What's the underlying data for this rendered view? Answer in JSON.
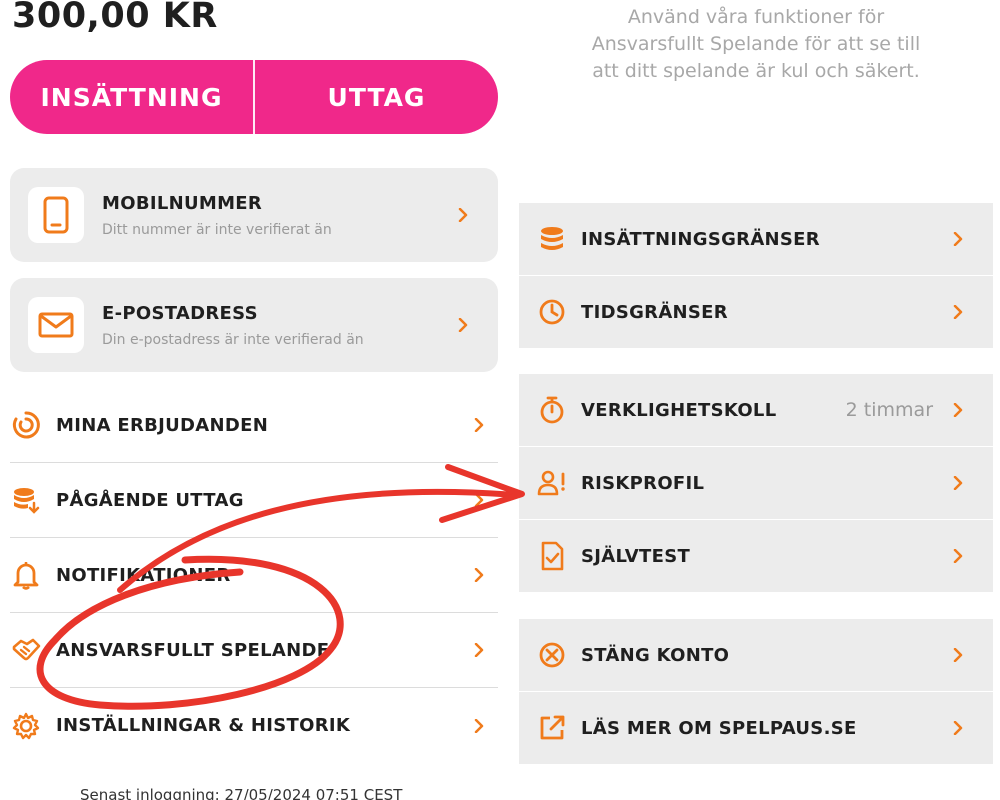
{
  "balance": "300,00 KR",
  "actions": {
    "deposit": "INSÄTTNING",
    "withdraw": "UTTAG"
  },
  "cards": [
    {
      "title": "MOBILNUMMER",
      "subtitle": "Ditt nummer är inte verifierat än",
      "icon": "phone-icon"
    },
    {
      "title": "E-POSTADRESS",
      "subtitle": "Din e-postadress är inte verifierad än",
      "icon": "mail-icon"
    }
  ],
  "menu": [
    {
      "label": "MINA ERBJUDANDEN",
      "icon": "offers-icon"
    },
    {
      "label": "PÅGÅENDE UTTAG",
      "icon": "coins-icon"
    },
    {
      "label": "NOTIFIKATIONER",
      "icon": "bell-icon"
    },
    {
      "label": "ANSVARSFULLT SPELANDE",
      "icon": "handshake-icon"
    },
    {
      "label": "INSTÄLLNINGAR & HISTORIK",
      "icon": "gear-icon"
    }
  ],
  "info_text": "Använd våra funktioner för Ansvarsfullt Spelande för att se till att ditt spelande är kul och säkert.",
  "responsible": {
    "limits": [
      {
        "label": "INSÄTTNINGSGRÄNSER",
        "icon": "coins-icon"
      },
      {
        "label": "TIDSGRÄNSER",
        "icon": "clock-icon"
      }
    ],
    "checks": [
      {
        "label": "VERKLIGHETSKOLL",
        "value": "2 timmar",
        "icon": "stopwatch-icon"
      },
      {
        "label": "RISKPROFIL",
        "icon": "user-alert-icon"
      },
      {
        "label": "SJÄLVTEST",
        "icon": "file-check-icon"
      }
    ],
    "account": [
      {
        "label": "STÄNG KONTO",
        "icon": "close-circle-icon"
      },
      {
        "label": "LÄS MER OM SPELPAUS.SE",
        "icon": "external-link-icon"
      }
    ]
  },
  "footer": "Senast inloggning: 27/05/2024 07:51 CEST",
  "colors": {
    "accent": "#f0288a",
    "icon": "#f07b1b",
    "annotation": "#e8352b",
    "panel": "#ececec"
  }
}
